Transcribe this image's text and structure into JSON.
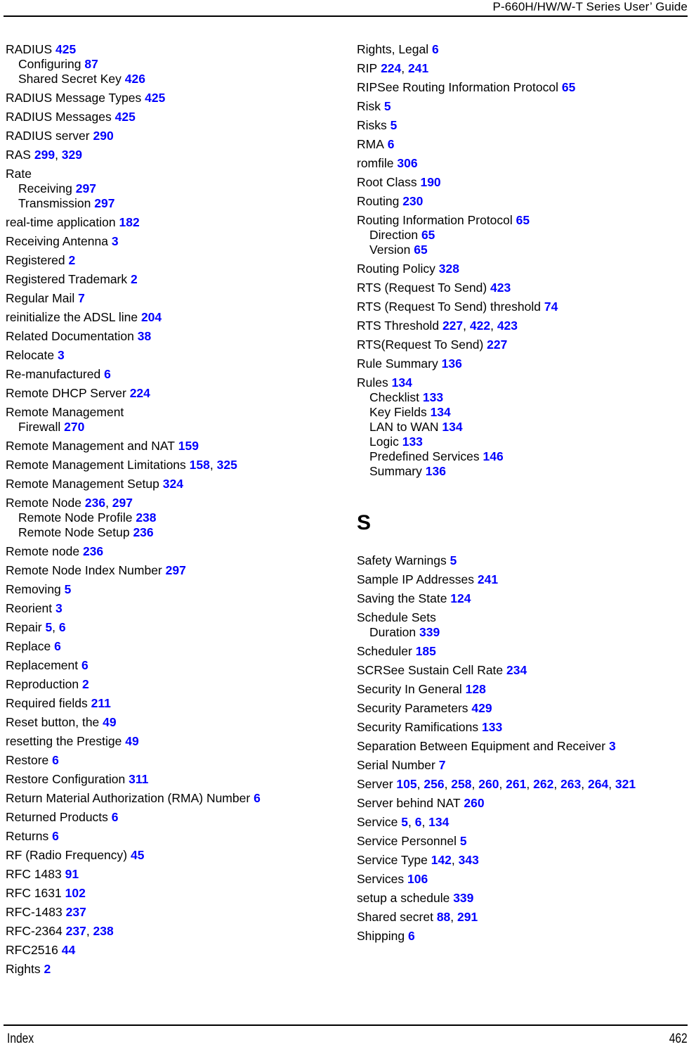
{
  "header": {
    "title": "P-660H/HW/W-T Series User’ Guide"
  },
  "footer": {
    "label": "Index",
    "page_number": "462"
  },
  "colors": {
    "page_number_link": "#0000FF",
    "text": "#000000",
    "background": "#FFFFFF"
  },
  "columns": [
    {
      "name": "left-column",
      "blocks": [
        {
          "type": "entries",
          "items": [
            {
              "level": 0,
              "text": "RADIUS",
              "pages": [
                "425"
              ]
            },
            {
              "level": 1,
              "text": "Configuring",
              "pages": [
                "87"
              ]
            },
            {
              "level": 1,
              "text": "Shared Secret Key",
              "pages": [
                "426"
              ]
            },
            {
              "level": 0,
              "text": "RADIUS Message Types",
              "pages": [
                "425"
              ]
            },
            {
              "level": 0,
              "text": "RADIUS Messages",
              "pages": [
                "425"
              ]
            },
            {
              "level": 0,
              "text": "RADIUS server",
              "pages": [
                "290"
              ]
            },
            {
              "level": 0,
              "text": "RAS",
              "pages": [
                "299",
                "329"
              ]
            },
            {
              "level": 0,
              "text": "Rate",
              "pages": []
            },
            {
              "level": 1,
              "text": "Receiving",
              "pages": [
                "297"
              ]
            },
            {
              "level": 1,
              "text": "Transmission",
              "pages": [
                "297"
              ]
            },
            {
              "level": 0,
              "text": "real-time application",
              "pages": [
                "182"
              ]
            },
            {
              "level": 0,
              "text": "Receiving Antenna",
              "pages": [
                "3"
              ]
            },
            {
              "level": 0,
              "text": "Registered",
              "pages": [
                "2"
              ]
            },
            {
              "level": 0,
              "text": "Registered Trademark",
              "pages": [
                "2"
              ]
            },
            {
              "level": 0,
              "text": "Regular Mail",
              "pages": [
                "7"
              ]
            },
            {
              "level": 0,
              "text": "reinitialize the ADSL line",
              "pages": [
                "204"
              ]
            },
            {
              "level": 0,
              "text": "Related Documentation",
              "pages": [
                "38"
              ]
            },
            {
              "level": 0,
              "text": "Relocate",
              "pages": [
                "3"
              ]
            },
            {
              "level": 0,
              "text": "Re-manufactured",
              "pages": [
                "6"
              ]
            },
            {
              "level": 0,
              "text": "Remote DHCP Server",
              "pages": [
                "224"
              ]
            },
            {
              "level": 0,
              "text": "Remote Management",
              "pages": []
            },
            {
              "level": 1,
              "text": "Firewall",
              "pages": [
                "270"
              ]
            },
            {
              "level": 0,
              "text": "Remote Management and NAT",
              "pages": [
                "159"
              ]
            },
            {
              "level": 0,
              "text": "Remote Management Limitations",
              "pages": [
                "158",
                "325"
              ]
            },
            {
              "level": 0,
              "text": "Remote Management Setup",
              "pages": [
                "324"
              ]
            },
            {
              "level": 0,
              "text": "Remote Node",
              "pages": [
                "236",
                "297"
              ]
            },
            {
              "level": 1,
              "text": "Remote Node Profile",
              "pages": [
                "238"
              ]
            },
            {
              "level": 1,
              "text": "Remote Node Setup",
              "pages": [
                "236"
              ]
            },
            {
              "level": 0,
              "text": "Remote node",
              "pages": [
                "236"
              ]
            },
            {
              "level": 0,
              "text": "Remote Node Index Number",
              "pages": [
                "297"
              ]
            },
            {
              "level": 0,
              "text": "Removing",
              "pages": [
                "5"
              ]
            },
            {
              "level": 0,
              "text": "Reorient",
              "pages": [
                "3"
              ]
            },
            {
              "level": 0,
              "text": "Repair",
              "pages": [
                "5",
                "6"
              ]
            },
            {
              "level": 0,
              "text": "Replace",
              "pages": [
                "6"
              ]
            },
            {
              "level": 0,
              "text": "Replacement",
              "pages": [
                "6"
              ]
            },
            {
              "level": 0,
              "text": "Reproduction",
              "pages": [
                "2"
              ]
            },
            {
              "level": 0,
              "text": "Required fields",
              "pages": [
                "211"
              ]
            },
            {
              "level": 0,
              "text": "Reset button, the",
              "pages": [
                "49"
              ]
            },
            {
              "level": 0,
              "text": "resetting the Prestige",
              "pages": [
                "49"
              ]
            },
            {
              "level": 0,
              "text": "Restore",
              "pages": [
                "6"
              ]
            },
            {
              "level": 0,
              "text": "Restore Configuration",
              "pages": [
                "311"
              ]
            },
            {
              "level": 0,
              "text": "Return Material Authorization (RMA) Number",
              "pages": [
                "6"
              ]
            },
            {
              "level": 0,
              "text": "Returned Products",
              "pages": [
                "6"
              ]
            },
            {
              "level": 0,
              "text": "Returns",
              "pages": [
                "6"
              ]
            },
            {
              "level": 0,
              "text": "RF (Radio Frequency)",
              "pages": [
                "45"
              ]
            },
            {
              "level": 0,
              "text": "RFC 1483",
              "pages": [
                "91"
              ]
            },
            {
              "level": 0,
              "text": "RFC 1631",
              "pages": [
                "102"
              ]
            },
            {
              "level": 0,
              "text": "RFC-1483",
              "pages": [
                "237"
              ]
            },
            {
              "level": 0,
              "text": "RFC-2364",
              "pages": [
                "237",
                "238"
              ]
            },
            {
              "level": 0,
              "text": "RFC2516",
              "pages": [
                "44"
              ]
            },
            {
              "level": 0,
              "text": "Rights",
              "pages": [
                "2"
              ]
            }
          ]
        }
      ]
    },
    {
      "name": "right-column",
      "blocks": [
        {
          "type": "entries",
          "items": [
            {
              "level": 0,
              "text": "Rights, Legal",
              "pages": [
                "6"
              ]
            },
            {
              "level": 0,
              "text": "RIP",
              "pages": [
                "224",
                "241"
              ]
            },
            {
              "level": 0,
              "text": "RIPSee Routing Information Protocol",
              "pages": [
                "65"
              ]
            },
            {
              "level": 0,
              "text": "Risk",
              "pages": [
                "5"
              ]
            },
            {
              "level": 0,
              "text": "Risks",
              "pages": [
                "5"
              ]
            },
            {
              "level": 0,
              "text": "RMA",
              "pages": [
                "6"
              ]
            },
            {
              "level": 0,
              "text": "romfile",
              "pages": [
                "306"
              ]
            },
            {
              "level": 0,
              "text": "Root Class",
              "pages": [
                "190"
              ]
            },
            {
              "level": 0,
              "text": "Routing",
              "pages": [
                "230"
              ]
            },
            {
              "level": 0,
              "text": "Routing Information Protocol",
              "pages": [
                "65"
              ]
            },
            {
              "level": 1,
              "text": "Direction",
              "pages": [
                "65"
              ]
            },
            {
              "level": 1,
              "text": "Version",
              "pages": [
                "65"
              ]
            },
            {
              "level": 0,
              "text": "Routing Policy",
              "pages": [
                "328"
              ]
            },
            {
              "level": 0,
              "text": "RTS (Request To Send)",
              "pages": [
                "423"
              ]
            },
            {
              "level": 0,
              "text": "RTS (Request To Send) threshold",
              "pages": [
                "74"
              ]
            },
            {
              "level": 0,
              "text": "RTS Threshold",
              "pages": [
                "227",
                "422",
                "423"
              ]
            },
            {
              "level": 0,
              "text": "RTS(Request To Send)",
              "pages": [
                "227"
              ]
            },
            {
              "level": 0,
              "text": "Rule Summary",
              "pages": [
                "136"
              ]
            },
            {
              "level": 0,
              "text": "Rules",
              "pages": [
                "134"
              ]
            },
            {
              "level": 1,
              "text": "Checklist",
              "pages": [
                "133"
              ]
            },
            {
              "level": 1,
              "text": "Key Fields",
              "pages": [
                "134"
              ]
            },
            {
              "level": 1,
              "text": "LAN to WAN",
              "pages": [
                "134"
              ]
            },
            {
              "level": 1,
              "text": "Logic",
              "pages": [
                "133"
              ]
            },
            {
              "level": 1,
              "text": "Predefined Services",
              "pages": [
                "146"
              ]
            },
            {
              "level": 1,
              "text": "Summary",
              "pages": [
                "136"
              ]
            }
          ]
        },
        {
          "type": "letter-heading",
          "letter": "S"
        },
        {
          "type": "entries",
          "items": [
            {
              "level": 0,
              "text": "Safety Warnings",
              "pages": [
                "5"
              ]
            },
            {
              "level": 0,
              "text": "Sample IP Addresses",
              "pages": [
                "241"
              ]
            },
            {
              "level": 0,
              "text": "Saving the State",
              "pages": [
                "124"
              ]
            },
            {
              "level": 0,
              "text": "Schedule Sets",
              "pages": []
            },
            {
              "level": 1,
              "text": "Duration",
              "pages": [
                "339"
              ]
            },
            {
              "level": 0,
              "text": "Scheduler",
              "pages": [
                "185"
              ]
            },
            {
              "level": 0,
              "text": "SCRSee Sustain Cell Rate",
              "pages": [
                "234"
              ]
            },
            {
              "level": 0,
              "text": "Security In General",
              "pages": [
                "128"
              ]
            },
            {
              "level": 0,
              "text": "Security Parameters",
              "pages": [
                "429"
              ]
            },
            {
              "level": 0,
              "text": "Security Ramifications",
              "pages": [
                "133"
              ]
            },
            {
              "level": 0,
              "text": "Separation Between Equipment and Receiver",
              "pages": [
                "3"
              ]
            },
            {
              "level": 0,
              "text": "Serial Number",
              "pages": [
                "7"
              ]
            },
            {
              "level": 0,
              "text": "Server",
              "pages": [
                "105",
                "256",
                "258",
                "260",
                "261",
                "262",
                "263",
                "264",
                "321"
              ]
            },
            {
              "level": 0,
              "text": "Server behind NAT",
              "pages": [
                "260"
              ]
            },
            {
              "level": 0,
              "text": "Service",
              "pages": [
                "5",
                "6",
                "134"
              ]
            },
            {
              "level": 0,
              "text": "Service Personnel",
              "pages": [
                "5"
              ]
            },
            {
              "level": 0,
              "text": "Service Type",
              "pages": [
                "142",
                "343"
              ]
            },
            {
              "level": 0,
              "text": "Services",
              "pages": [
                "106"
              ]
            },
            {
              "level": 0,
              "text": "setup a schedule",
              "pages": [
                "339"
              ]
            },
            {
              "level": 0,
              "text": "Shared secret",
              "pages": [
                "88",
                "291"
              ]
            },
            {
              "level": 0,
              "text": "Shipping",
              "pages": [
                "6"
              ]
            }
          ]
        }
      ]
    }
  ]
}
